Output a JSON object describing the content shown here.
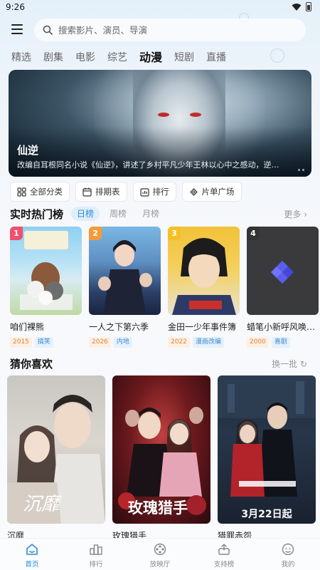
{
  "status_bar": {
    "time": "9:26"
  },
  "search": {
    "placeholder": "搜索影片、演员、导演"
  },
  "category_tabs": [
    {
      "label": "精选",
      "active": false
    },
    {
      "label": "剧集",
      "active": false
    },
    {
      "label": "电影",
      "active": false
    },
    {
      "label": "综艺",
      "active": false
    },
    {
      "label": "动漫",
      "active": true
    },
    {
      "label": "短剧",
      "active": false
    },
    {
      "label": "直播",
      "active": false
    }
  ],
  "banner": {
    "title": "仙逆",
    "description": "改编自耳根同名小说《仙逆》，讲述了乡村平凡少年王林以心中之感动，逆…"
  },
  "quick_actions": [
    {
      "label": "全部分类",
      "icon": "grid-icon"
    },
    {
      "label": "排期表",
      "icon": "calendar-icon"
    },
    {
      "label": "排行",
      "icon": "ranking-icon"
    },
    {
      "label": "片单广场",
      "icon": "playlist-icon"
    }
  ],
  "hot_ranking": {
    "title": "实时热门榜",
    "tabs": [
      {
        "label": "日榜",
        "active": true
      },
      {
        "label": "周榜",
        "active": false
      },
      {
        "label": "月榜",
        "active": false
      }
    ],
    "more_label": "更多 ›",
    "items": [
      {
        "rank": "1",
        "name": "咱们裸熊",
        "year": "2015",
        "genre": "搞笑",
        "badge_color": "#f0506e"
      },
      {
        "rank": "2",
        "name": "一人之下第六季",
        "year": "2026",
        "genre": "内地",
        "badge_color": "#f59a3a"
      },
      {
        "rank": "3",
        "name": "金田一少年事件簿",
        "year": "2022",
        "genre": "漫画改编",
        "badge_color": "#f5c026"
      },
      {
        "rank": "4",
        "name": "蜡笔小新呼风唤雨…",
        "year": "2000",
        "genre": "喜剧",
        "badge_color": "#333333"
      }
    ]
  },
  "guess": {
    "title": "猜你喜欢",
    "refresh_label": "换一批 ↻",
    "items": [
      {
        "name": "沉靡",
        "poster_text": "沉靡"
      },
      {
        "name": "玫瑰猎手",
        "poster_text": "玫瑰猎手"
      },
      {
        "name": "猎罪赤怨",
        "poster_text": "3月22日起"
      }
    ]
  },
  "bottom_nav": [
    {
      "label": "首页",
      "icon": "home-icon",
      "active": true
    },
    {
      "label": "排行",
      "icon": "ranking-icon",
      "active": false
    },
    {
      "label": "放映厅",
      "icon": "film-reel-icon",
      "active": false
    },
    {
      "label": "支持榜",
      "icon": "support-icon",
      "active": false
    },
    {
      "label": "我的",
      "icon": "profile-icon",
      "active": false
    }
  ],
  "colors": {
    "accent": "#2a8ae0",
    "background": "#eef4fa"
  }
}
